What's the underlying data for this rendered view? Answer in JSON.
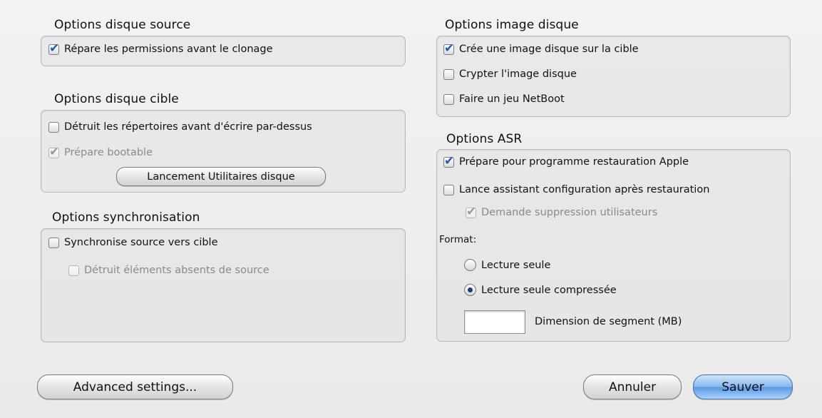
{
  "source_disk": {
    "title": "Options disque source",
    "repair_permissions": {
      "label": "Répare les permissions avant le clonage",
      "checked": true
    }
  },
  "target_disk": {
    "title": "Options disque cible",
    "erase_dirs": {
      "label": "Détruit les répertoires avant d'écrire par-dessus",
      "checked": false
    },
    "make_bootable": {
      "label": "Prépare bootable",
      "checked": true,
      "enabled": false
    },
    "disk_utility_button": "Lancement Utilitaires disque"
  },
  "sync": {
    "title": "Options synchronisation",
    "sync_source": {
      "label": "Synchronise source vers cible",
      "checked": false
    },
    "delete_missing": {
      "label": "Détruit éléments absents de source",
      "checked": false,
      "enabled": false
    }
  },
  "disk_image": {
    "title": "Options image disque",
    "create_image": {
      "label": "Crée une image disque sur la cible",
      "checked": true
    },
    "encrypt_image": {
      "label": "Crypter l'image disque",
      "checked": false
    },
    "netboot": {
      "label": "Faire un jeu NetBoot",
      "checked": false
    }
  },
  "asr": {
    "title": "Options ASR",
    "prepare_restore": {
      "label": "Prépare pour programme restauration Apple",
      "checked": true
    },
    "setup_assistant": {
      "label": "Lance assistant configuration après restauration",
      "checked": false
    },
    "ask_delete_users": {
      "label": "Demande suppression utilisateurs",
      "checked": true,
      "enabled": false
    },
    "format_label": "Format:",
    "format_options": [
      "Lecture seule",
      "Lecture seule compressée"
    ],
    "format_selected": "Lecture seule compressée",
    "segment_value": "",
    "segment_label": "Dimension de segment (MB)"
  },
  "buttons": {
    "advanced": "Advanced settings...",
    "cancel": "Annuler",
    "save": "Sauver"
  },
  "colors": {
    "accent": "#5b97e3",
    "check": "#1f57b8"
  }
}
